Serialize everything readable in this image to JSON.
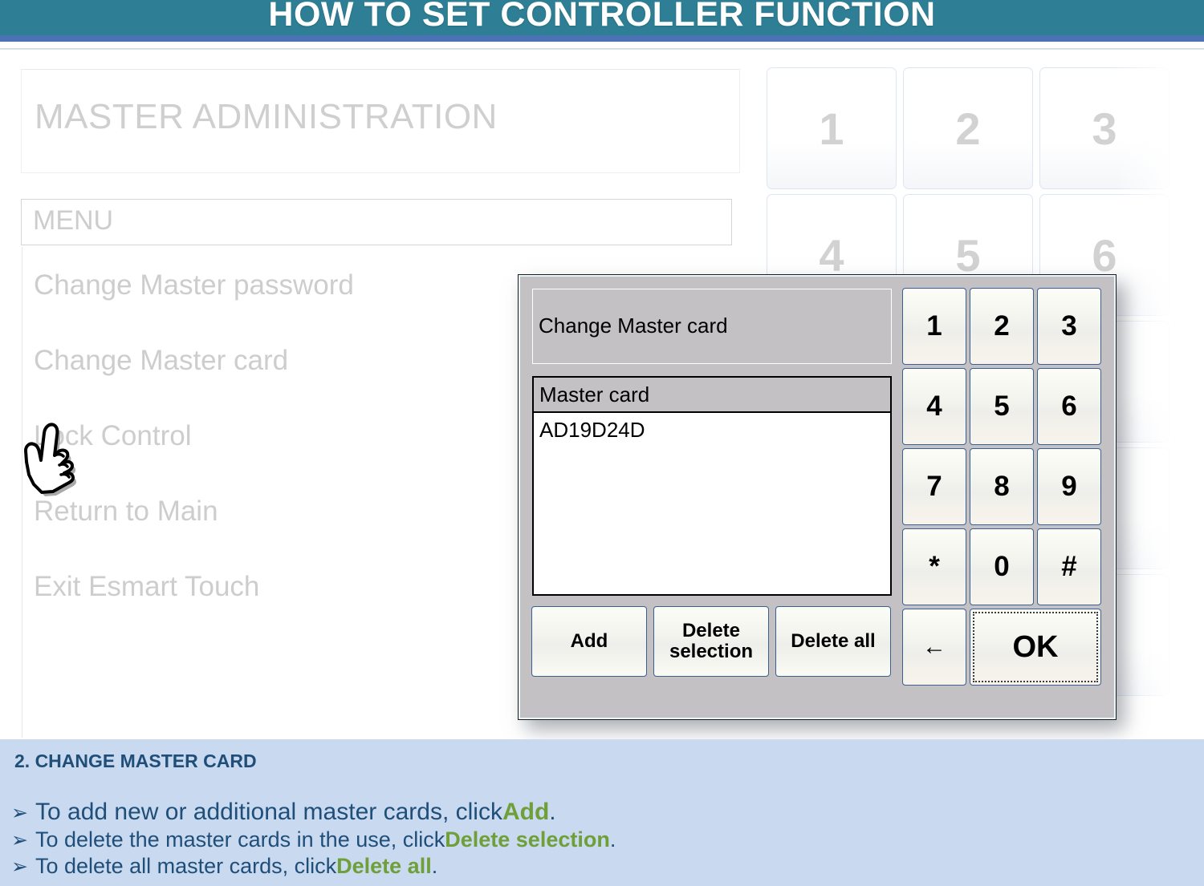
{
  "slide": {
    "title": "HOW TO SET CONTROLLER FUNCTION",
    "title_bg": "#2e7f95",
    "title_rule": "#4a72b5"
  },
  "background_app": {
    "screen_title": "MASTER ADMINISTRATION",
    "menu_field_label": "MENU",
    "menu_items": [
      "Change Master password",
      "Change Master card",
      "Lock Control",
      "Return to Main",
      "Exit Esmart Touch"
    ],
    "keypad_keys": [
      "1",
      "2",
      "3",
      "4",
      "5",
      "6"
    ]
  },
  "dialog": {
    "title": "Change Master card",
    "list": {
      "column_header": "Master card",
      "rows": [
        "AD19D24D"
      ]
    },
    "buttons": [
      {
        "label": "Add",
        "lines": [
          "Add"
        ]
      },
      {
        "label": "Delete selection",
        "lines": [
          "Delete",
          "selection"
        ]
      },
      {
        "label": "Delete all",
        "lines": [
          "Delete all"
        ]
      }
    ],
    "keypad": {
      "keys": [
        "1",
        "2",
        "3",
        "4",
        "5",
        "6",
        "7",
        "8",
        "9",
        "*",
        "0",
        "#"
      ],
      "backspace": "←",
      "confirm": "OK"
    }
  },
  "caption": {
    "heading": "2. CHANGE MASTER CARD",
    "bullet_glyph": "➢",
    "lines": [
      {
        "pre": "To add new or additional master cards, click ",
        "highlight": "Add",
        "post": "."
      },
      {
        "pre": " To delete the master cards in  the use, click ",
        "highlight": "Delete selection",
        "post": "."
      },
      {
        "pre": " To delete all master cards, click ",
        "highlight": "Delete all",
        "post": "."
      }
    ],
    "bg_color": "#c9d9ef",
    "text_color": "#1f4e79",
    "highlight_color": "#6f9f38"
  }
}
